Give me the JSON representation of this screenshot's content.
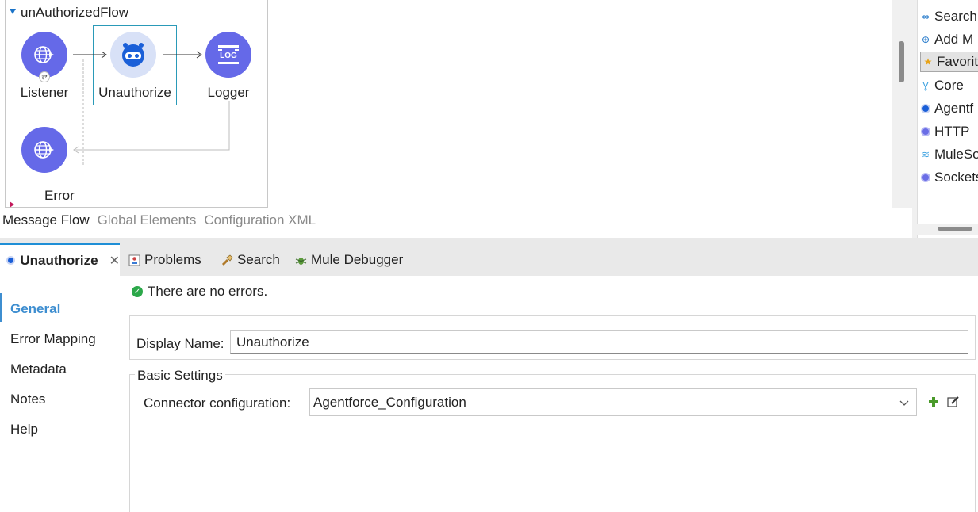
{
  "canvas": {
    "flow_title": "unAuthorizedFlow",
    "nodes": {
      "listener": "Listener",
      "unauthorize": "Unauthorize",
      "logger": "Logger"
    },
    "error_label": "Error",
    "tabs": [
      "Message Flow",
      "Global Elements",
      "Configuration XML"
    ]
  },
  "palette": {
    "items": [
      "Search",
      "Add M",
      "Favorite",
      "Core",
      "Agentf",
      "HTTP",
      "MuleSo",
      "Sockets"
    ]
  },
  "bottom": {
    "props_tab": "Unauthorize",
    "tabs": {
      "problems": "Problems",
      "search": "Search",
      "debugger": "Mule Debugger"
    },
    "nav": [
      "General",
      "Error Mapping",
      "Metadata",
      "Notes",
      "Help"
    ],
    "status_message": "There are no errors.",
    "display_name_label": "Display Name:",
    "display_name_value": "Unauthorize",
    "basic_settings": "Basic Settings",
    "connector_label": "Connector configuration:",
    "connector_value": "Agentforce_Configuration"
  },
  "colors": {
    "node_fill": "#6569e8",
    "selection_border": "#2a9ab8",
    "active_nav": "#3e8ed0",
    "ok_green": "#2ca84a"
  }
}
